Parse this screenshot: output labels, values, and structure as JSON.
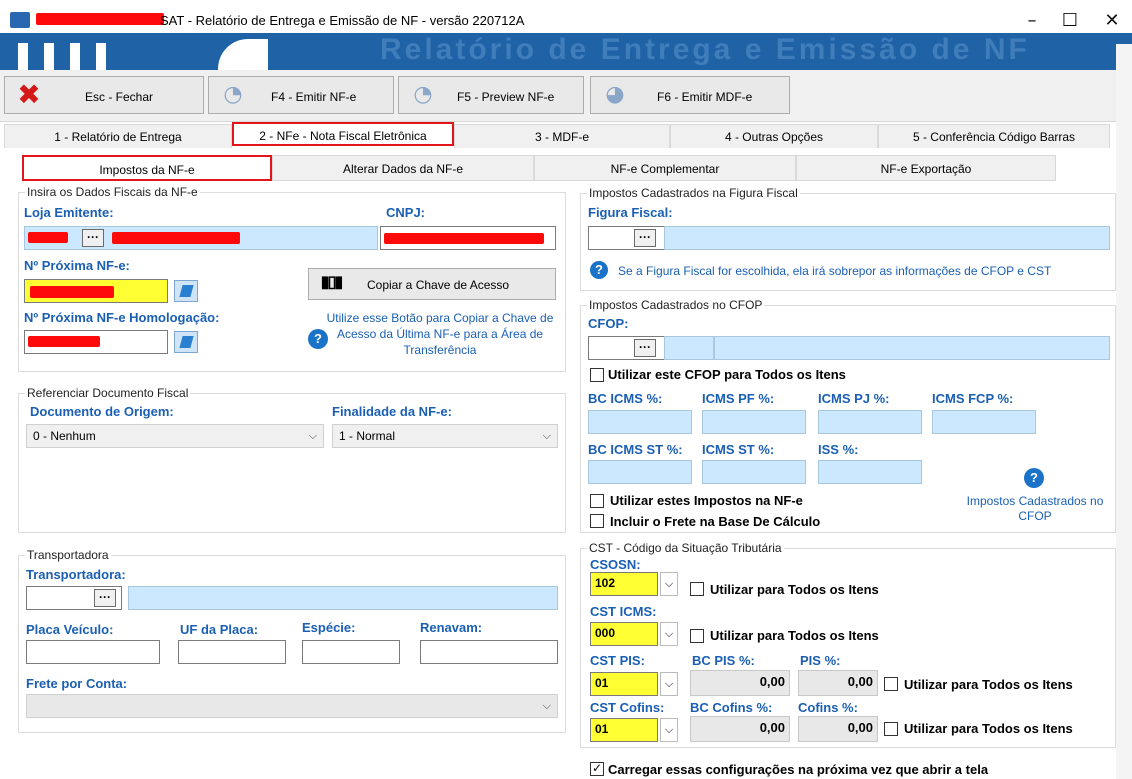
{
  "window": {
    "title": "SAT - Relatório de Entrega e Emissão de NF - versão 220712A",
    "banner_text": "Relatório de Entrega e Emissão de NF"
  },
  "toolbar": {
    "close_label": "Esc - Fechar",
    "emit_nfe_label": "F4 - Emitir NF-e",
    "preview_nfe_label": "F5 - Preview NF-e",
    "emit_mdfe_label": "F6 - Emitir MDF-e"
  },
  "tabs": [
    {
      "label": "1 - Relatório de Entrega"
    },
    {
      "label": "2 - NFe - Nota Fiscal Eletrônica"
    },
    {
      "label": "3 - MDF-e"
    },
    {
      "label": "4 - Outras Opções"
    },
    {
      "label": "5 - Conferência Código Barras"
    }
  ],
  "subtabs": [
    {
      "label": "Impostos da NF-e"
    },
    {
      "label": "Alterar Dados da NF-e"
    },
    {
      "label": "NF-e Complementar"
    },
    {
      "label": "NF-e Exportação"
    }
  ],
  "fiscal": {
    "group_title": "Insira os Dados Fiscais da NF-e",
    "loja_label": "Loja Emitente:",
    "cnpj_label": "CNPJ:",
    "proxima_label": "Nº Próxima NF-e:",
    "proxima_homolog_label": "Nº Próxima NF-e Homologação:",
    "copy_key_label": "Copiar a Chave de Acesso",
    "copy_key_help": "Utilize esse Botão para Copiar a Chave de Acesso da Última NF-e para a Área de Transferência"
  },
  "referencia": {
    "group_title": "Referenciar Documento Fiscal",
    "origem_label": "Documento de Origem:",
    "origem_value": "0 - Nenhum",
    "finalidade_label": "Finalidade da NF-e:",
    "finalidade_value": "1 - Normal"
  },
  "transporte": {
    "group_title": "Transportadora",
    "transportadora_label": "Transportadora:",
    "placa_label": "Placa Veículo:",
    "uf_label": "UF da Placa:",
    "especie_label": "Espécie:",
    "renavam_label": "Renavam:",
    "frete_label": "Frete por Conta:"
  },
  "figura": {
    "group_title": "Impostos Cadastrados na Figura Fiscal",
    "label": "Figura Fiscal:",
    "help": "Se a Figura Fiscal for escolhida, ela irá sobrepor as informações de CFOP e CST"
  },
  "cfop": {
    "group_title": "Impostos Cadastrados no CFOP",
    "label": "CFOP:",
    "use_all_label": "Utilizar este CFOP para Todos os Itens",
    "bc_icms_label": "BC ICMS %:",
    "icms_pf_label": "ICMS PF %:",
    "icms_pj_label": "ICMS PJ %:",
    "icms_fcp_label": "ICMS FCP %:",
    "bc_icms_st_label": "BC ICMS ST %:",
    "icms_st_label": "ICMS ST %:",
    "iss_label": "ISS %:",
    "use_taxes_label": "Utilizar estes Impostos na NF-e",
    "include_freight_label": "Incluir o Frete na Base De Cálculo",
    "help_label": "Impostos Cadastrados no CFOP"
  },
  "cst": {
    "group_title": "CST - Código da Situação Tributária",
    "csosn_label": "CSOSN:",
    "csosn_value": "102",
    "cst_icms_label": "CST ICMS:",
    "cst_icms_value": "000",
    "cst_pis_label": "CST PIS:",
    "cst_pis_value": "01",
    "bc_pis_label": "BC PIS %:",
    "bc_pis_value": "0,00",
    "pis_label": "PIS %:",
    "pis_value": "0,00",
    "cst_cofins_label": "CST Cofins:",
    "cst_cofins_value": "01",
    "bc_cofins_label": "BC Cofins %:",
    "bc_cofins_value": "0,00",
    "cofins_label": "Cofins %:",
    "cofins_value": "0,00",
    "use_all_label": "Utilizar para Todos os Itens"
  },
  "footer": {
    "load_config_label": "Carregar essas configurações na próxima vez que abrir a tela"
  },
  "icons": {
    "close": "close-x-icon",
    "nfe": "globe-icon",
    "info": "info-icon",
    "barcode": "barcode-icon"
  },
  "colors": {
    "label_blue": "#1a5fb4",
    "highlight_red": "#e4141b",
    "field_blue": "#cce8ff",
    "field_yellow": "#ffff33",
    "banner": "#1f62a6"
  }
}
